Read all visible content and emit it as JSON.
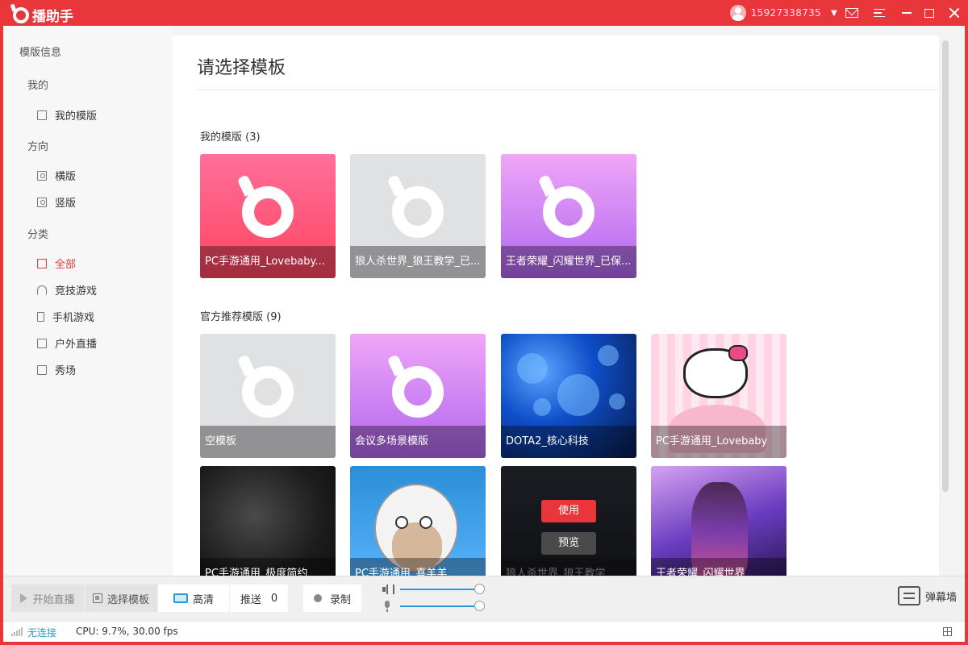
{
  "app": {
    "title": "播助手",
    "phone": "15927338735"
  },
  "sidebar": {
    "heading": "模版信息",
    "groups": [
      {
        "title": "我的",
        "items": [
          {
            "label": "我的模版",
            "icon": "template-icon"
          }
        ]
      },
      {
        "title": "方向",
        "items": [
          {
            "label": "横版",
            "icon": "person-icon"
          },
          {
            "label": "竖版",
            "icon": "person-icon"
          }
        ]
      },
      {
        "title": "分类",
        "items": [
          {
            "label": "全部",
            "icon": "copy-icon",
            "active": true
          },
          {
            "label": "竞技游戏",
            "icon": "headset-icon"
          },
          {
            "label": "手机游戏",
            "icon": "phone-icon"
          },
          {
            "label": "户外直播",
            "icon": "monitor-icon"
          },
          {
            "label": "秀场",
            "icon": "square-icon"
          }
        ]
      }
    ]
  },
  "main": {
    "title": "请选择模板",
    "my_section": {
      "label": "我的模版 (3)"
    },
    "official_section": {
      "label": "官方推荐模版 (9)"
    },
    "my_templates": [
      {
        "caption": "PC手游通用_Lovebaby...",
        "style": "pink"
      },
      {
        "caption": "狼人杀世界_狼王教学_已...",
        "style": "gray"
      },
      {
        "caption": "王者荣耀_闪耀世界_已保...",
        "style": "purple"
      }
    ],
    "official_templates": [
      {
        "caption": "空模板",
        "style": "gray"
      },
      {
        "caption": "会议多场景模版",
        "style": "purple"
      },
      {
        "caption": "DOTA2_核心科技",
        "style": "blue-bokeh"
      },
      {
        "caption": "PC手游通用_Lovebaby",
        "style": "kitty"
      },
      {
        "caption": "PC手游通用_极度简约",
        "style": "dark"
      },
      {
        "caption": "PC手游通用_喜羊羊",
        "style": "sheep"
      },
      {
        "caption": "狼人杀世界_狼王教学",
        "style": "wolf",
        "hover": true
      },
      {
        "caption": "王者荣耀_闪耀世界",
        "style": "wz"
      }
    ],
    "hover_actions": {
      "use": "使用",
      "preview": "预览"
    }
  },
  "toolbar": {
    "start_live": "开始直播",
    "select_template": "选择模板",
    "quality": "高清",
    "push_label": "推送",
    "push_count": "0",
    "record": "录制",
    "danmu": "弹幕墙",
    "speaker_volume": 1.0,
    "mic_volume": 1.0
  },
  "status": {
    "connection": "无连接",
    "cpu": "CPU: 9.7%, 30.00 fps"
  },
  "colors": {
    "accent": "#e8363a",
    "link": "#2a9ad6"
  }
}
